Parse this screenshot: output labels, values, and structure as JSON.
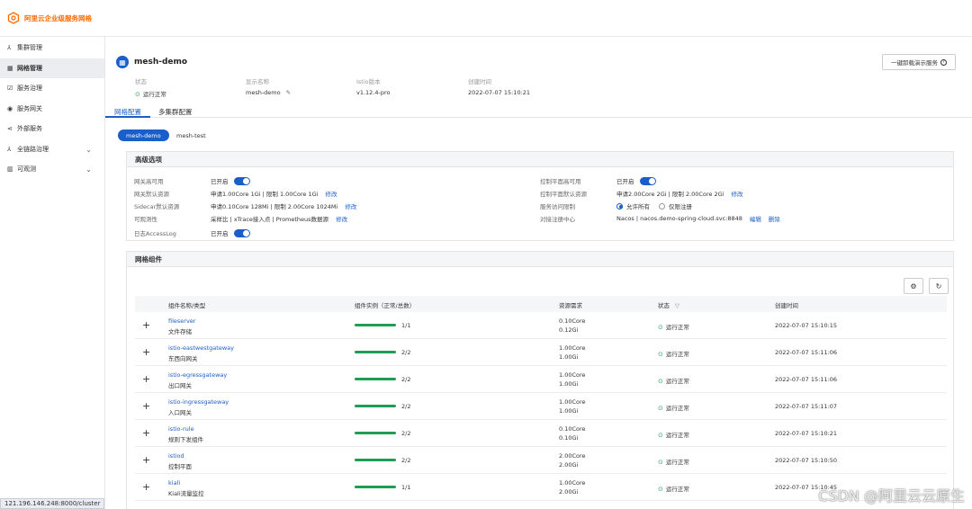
{
  "brand": {
    "name": "阿里云企业级服务网格",
    "color": "#ff6a00"
  },
  "sidebar": {
    "items": [
      {
        "label": "集群管理",
        "icon": "cluster-icon",
        "glyph": "⅄",
        "active": false,
        "expandable": false
      },
      {
        "label": "网格管理",
        "icon": "grid-icon",
        "glyph": "▦",
        "active": true,
        "expandable": false
      },
      {
        "label": "服务治理",
        "icon": "service-governance-icon",
        "glyph": "☑",
        "active": false,
        "expandable": false
      },
      {
        "label": "服务网关",
        "icon": "gateway-icon",
        "glyph": "◉",
        "active": false,
        "expandable": false
      },
      {
        "label": "外部服务",
        "icon": "share-icon",
        "glyph": "⋖",
        "active": false,
        "expandable": false
      },
      {
        "label": "全链路治理",
        "icon": "trace-icon",
        "glyph": "⅄",
        "active": false,
        "expandable": true
      },
      {
        "label": "可观测",
        "icon": "chart-icon",
        "glyph": "▥",
        "active": false,
        "expandable": true
      }
    ]
  },
  "statusbar": {
    "url": "121.196.146.248:8000/cluster"
  },
  "header": {
    "title": "mesh-demo",
    "uninstall_label": "一键卸载演示服务",
    "info": [
      {
        "label": "状态",
        "value": "运行正常"
      },
      {
        "label": "显示名称",
        "value": "mesh-demo"
      },
      {
        "label": "Istio版本",
        "value": "v1.12.4-pro"
      },
      {
        "label": "创建时间",
        "value": "2022-07-07 15:10:21"
      }
    ]
  },
  "tabs": [
    {
      "label": "网格配置",
      "active": true
    },
    {
      "label": "多集群配置",
      "active": false
    }
  ],
  "mesh_pills": [
    {
      "label": "mesh-demo",
      "active": true
    },
    {
      "label": "mesh-test",
      "active": false
    }
  ],
  "advanced": {
    "title": "高级选项",
    "left": [
      {
        "label": "网关高可用",
        "value": "已开启",
        "toggle": true,
        "link": ""
      },
      {
        "label": "网关默认资源",
        "value": "申请1.00Core 1Gi | 限制 1.00Core 1Gi",
        "toggle": false,
        "link": "修改"
      },
      {
        "label": "Sidecar默认资源",
        "value": "申请0.10Core 128Mi | 限制 2.00Core 1024Mi",
        "toggle": false,
        "link": "修改"
      },
      {
        "label": "可观测性",
        "value": "采样比 | xTrace接入点 | Prometheus数据源",
        "toggle": false,
        "link": "修改"
      },
      {
        "label": "日志AccessLog",
        "value": "已开启",
        "toggle": true,
        "link": ""
      }
    ],
    "right": [
      {
        "label": "控制平面高可用",
        "value": "已开启",
        "toggle": true
      },
      {
        "label": "控制平面默认资源",
        "value": "申请2.00Core 2Gi | 限制 2.00Core 2Gi",
        "link": "修改"
      },
      {
        "label": "服务访问限制",
        "radio_on": "允许所有",
        "radio_off": "仅限注册"
      },
      {
        "label": "对接注册中心",
        "value": "Nacos | nacos.demo-spring-cloud.svc:8848",
        "link1": "编辑",
        "link2": "删除"
      }
    ]
  },
  "components": {
    "title": "网格组件",
    "columns": [
      "组件名称/类型",
      "组件实例（正常/总数）",
      "资源需求",
      "状态",
      "创建时间"
    ],
    "rows": [
      {
        "name": "fileserver",
        "type": "文件存储",
        "ratio": 1.0,
        "count": "1/1",
        "cpu": "0.10Core",
        "mem": "0.12Gi",
        "status": "运行正常",
        "time": "2022-07-07 15:10:15"
      },
      {
        "name": "istio-eastwestgateway",
        "type": "东西向网关",
        "ratio": 1.0,
        "count": "2/2",
        "cpu": "1.00Core",
        "mem": "1.00Gi",
        "status": "运行正常",
        "time": "2022-07-07 15:11:06"
      },
      {
        "name": "istio-egressgateway",
        "type": "出口网关",
        "ratio": 1.0,
        "count": "2/2",
        "cpu": "1.00Core",
        "mem": "1.00Gi",
        "status": "运行正常",
        "time": "2022-07-07 15:11:06"
      },
      {
        "name": "istio-ingressgateway",
        "type": "入口网关",
        "ratio": 1.0,
        "count": "2/2",
        "cpu": "1.00Core",
        "mem": "1.00Gi",
        "status": "运行正常",
        "time": "2022-07-07 15:11:07"
      },
      {
        "name": "istio-rule",
        "type": "规则下发组件",
        "ratio": 1.0,
        "count": "2/2",
        "cpu": "0.10Core",
        "mem": "0.10Gi",
        "status": "运行正常",
        "time": "2022-07-07 15:10:21"
      },
      {
        "name": "istiod",
        "type": "控制平面",
        "ratio": 1.0,
        "count": "2/2",
        "cpu": "2.00Core",
        "mem": "2.00Gi",
        "status": "运行正常",
        "time": "2022-07-07 15:10:50"
      },
      {
        "name": "kiali",
        "type": "Kiali流量监控",
        "ratio": 1.0,
        "count": "1/1",
        "cpu": "1.00Core",
        "mem": "2.00Gi",
        "status": "运行正常",
        "time": "2022-07-07 15:10:45"
      }
    ]
  },
  "watermark": "CSDN @阿里云云原生",
  "colors": {
    "accent": "#1a5ec9",
    "ok": "#1f9d55"
  }
}
